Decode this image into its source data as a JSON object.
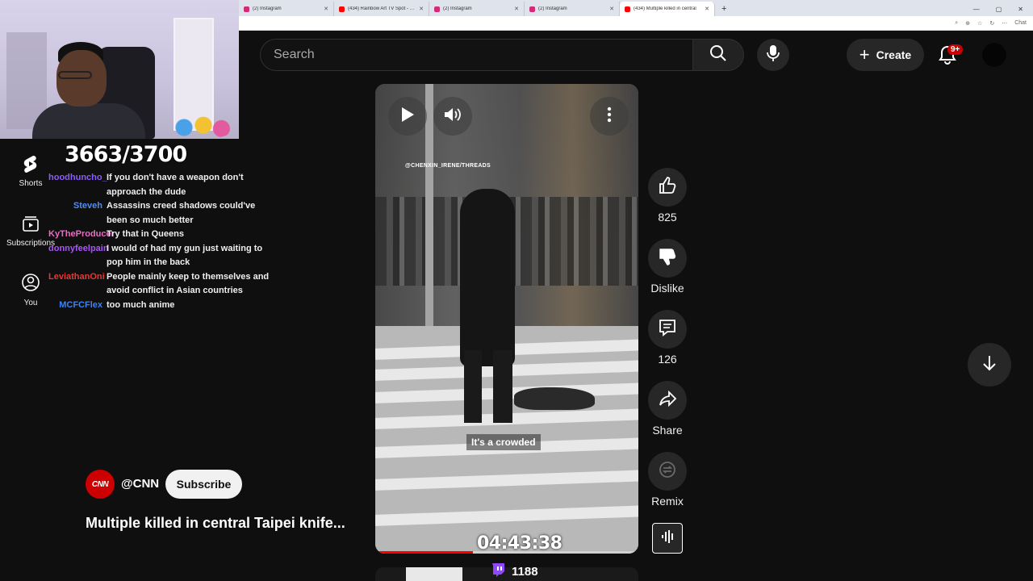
{
  "browser": {
    "tabs": [
      {
        "title": "(2) Instagram",
        "icon_color": "#d62976",
        "active": false
      },
      {
        "title": "(434) Rainbow Art TV Spot - YouTube",
        "icon_color": "#ff0000",
        "active": false
      },
      {
        "title": "(2) Instagram",
        "icon_color": "#d62976",
        "active": false
      },
      {
        "title": "(2) Instagram",
        "icon_color": "#d62976",
        "active": false
      },
      {
        "title": "(434) Multiple killed in central",
        "icon_color": "#ff0000",
        "active": true
      }
    ],
    "new_tab": "+",
    "address_icons": [
      "⌕",
      "⊕",
      "☆",
      "↻",
      "⋯",
      "Chat"
    ]
  },
  "stream": {
    "counter": "3663/3700",
    "timer": "04:43:38",
    "viewers": "1188"
  },
  "sidebar": {
    "items": [
      {
        "label": "Shorts",
        "icon": "shorts-icon"
      },
      {
        "label": "Subscriptions",
        "icon": "subscriptions-icon"
      },
      {
        "label": "You",
        "icon": "you-icon"
      }
    ]
  },
  "chat": {
    "messages": [
      {
        "user": "",
        "user_color": "#9147ff",
        "text": "..."
      },
      {
        "user": "hoodhuncho_",
        "user_color": "#8b5cf6",
        "text": "If you don't have a weapon don't approach the dude"
      },
      {
        "user": "Steveh",
        "user_color": "#4f8ef7",
        "text": "Assassins creed shadows could've been so much better"
      },
      {
        "user": "KyTheProducer",
        "user_color": "#e96cc6",
        "text": "Try that in Queens"
      },
      {
        "user": "donnyfeelpain",
        "user_color": "#a855f7",
        "text": "I would of had my gun just waiting to pop him in the back"
      },
      {
        "user": "LeviathanOni",
        "user_color": "#e53935",
        "text": "People mainly keep to themselves and avoid conflict in Asian countries"
      },
      {
        "user": "MCFCFlex",
        "user_color": "#3b82f6",
        "text": "too much anime"
      }
    ]
  },
  "header": {
    "search_placeholder": "Search",
    "create_label": "Create",
    "notifications_badge": "9+"
  },
  "video": {
    "watermark": "@CHENXIN_IRENE/THREADS",
    "caption": "It's a crowded",
    "progress_fraction": 0.37
  },
  "actions": {
    "likes": "825",
    "dislike_label": "Dislike",
    "comments": "126",
    "share_label": "Share",
    "remix_label": "Remix"
  },
  "channel": {
    "logo_text": "CNN",
    "handle": "@CNN",
    "subscribe_label": "Subscribe",
    "title": "Multiple killed in central Taipei knife..."
  },
  "colors": {
    "background": "#0f0f0f",
    "button_bg": "#272727",
    "accent_red": "#ff0000",
    "twitch_purple": "#9147ff"
  }
}
